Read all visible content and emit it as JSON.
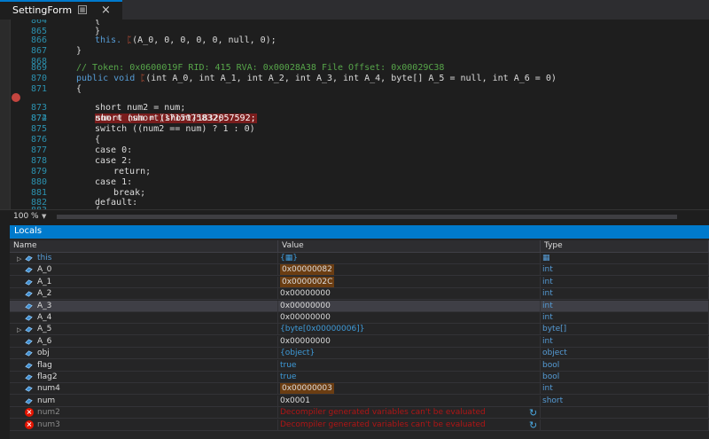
{
  "tab": {
    "title": "SettingForm",
    "pin_glyph": "▦",
    "close_glyph": "×"
  },
  "code_lines": [
    {
      "no": "864",
      "html": "{",
      "indent": "    "
    },
    {
      "no": "865",
      "html": "}",
      "indent": "    "
    },
    {
      "no": "866",
      "html": "this. ",
      "indent": "    ",
      "suffix": "(A_0, 0, 0, 0, 0, null, 0);"
    },
    {
      "no": "867",
      "html": "}",
      "indent": ""
    },
    {
      "no": "868",
      "html": "",
      "indent": ""
    },
    {
      "no": "869",
      "html": "// Token: 0x0600019F RID: 415 RVA: 0x00028A38 File Offset: 0x00029C38",
      "indent": ""
    },
    {
      "no": "870",
      "html": "public void ",
      "indent": ""
    },
    {
      "no": "871",
      "html": "{",
      "indent": ""
    },
    {
      "no": "872",
      "html": "short num = (short)1832057592;",
      "indent": "    "
    },
    {
      "no": "873",
      "html": "short num2 = num;",
      "indent": "    "
    },
    {
      "no": "874",
      "html": "num = (short)1715075832;",
      "indent": "    "
    },
    {
      "no": "875",
      "html": "switch ((num2 == num) ? 1 : 0)",
      "indent": "    "
    },
    {
      "no": "876",
      "html": "{",
      "indent": "    "
    },
    {
      "no": "877",
      "html": "case 0:",
      "indent": "    "
    },
    {
      "no": "878",
      "html": "case 2:",
      "indent": "    "
    },
    {
      "no": "879",
      "html": "return;",
      "indent": "        "
    },
    {
      "no": "880",
      "html": "case 1:",
      "indent": "    "
    },
    {
      "no": "881",
      "html": "break;",
      "indent": "        "
    },
    {
      "no": "882",
      "html": "default:",
      "indent": "    "
    },
    {
      "no": "883",
      "html": "{",
      "indent": "    "
    }
  ],
  "code": {
    "l864": "{",
    "l865": "}",
    "l866_a": "this.",
    "l866_b": "(A_0, 0, 0, 0, 0, null, 0);",
    "l867": "}",
    "l869": "// Token: 0x0600019F RID: 415 RVA: 0x00028A38 File Offset: 0x00029C38",
    "l870_kw1": "public",
    "l870_kw2": "void",
    "l870_params": "(int A_0, int A_1, int A_2, int A_3, int A_4, byte[] A_5 = null, int A_6 = 0)",
    "l871": "{",
    "l872": "short num = (short)1832057592;",
    "l873": "short num2 = num;",
    "l874": "num = (short)1715075832;",
    "l875": "switch ((num2 == num) ? 1 : 0)",
    "l876": "{",
    "l877": "case 0:",
    "l878": "case 2:",
    "l879": "return;",
    "l880": "case 1:",
    "l881": "break;",
    "l882": "default:",
    "l883": "{",
    "glyph": "ᛈ"
  },
  "line_numbers": [
    "864",
    "865",
    "866",
    "867",
    "868",
    "869",
    "870",
    "871",
    "872",
    "873",
    "874",
    "875",
    "876",
    "877",
    "878",
    "879",
    "880",
    "881",
    "882",
    "883"
  ],
  "zoom": "100 %",
  "locals": {
    "title": "Locals",
    "columns": {
      "name": "Name",
      "value": "Value",
      "type": "Type"
    },
    "rows": [
      {
        "name": "this",
        "value": "{▦}",
        "type": "▦",
        "expandable": true
      },
      {
        "name": "A_0",
        "value": "0x00000082",
        "type": "int",
        "changed": true
      },
      {
        "name": "A_1",
        "value": "0x0000002C",
        "type": "int",
        "changed": true
      },
      {
        "name": "A_2",
        "value": "0x00000000",
        "type": "int"
      },
      {
        "name": "A_3",
        "value": "0x00000000",
        "type": "int",
        "selected": true
      },
      {
        "name": "A_4",
        "value": "0x00000000",
        "type": "int"
      },
      {
        "name": "A_5",
        "value": "{byte[0x00000006]}",
        "type": "byte[]",
        "expandable": true
      },
      {
        "name": "A_6",
        "value": "0x00000000",
        "type": "int"
      },
      {
        "name": "obj",
        "value": "{object}",
        "type": "object"
      },
      {
        "name": "flag",
        "value": "true",
        "type": "bool"
      },
      {
        "name": "flag2",
        "value": "true",
        "type": "bool"
      },
      {
        "name": "num4",
        "value": "0x00000003",
        "type": "int",
        "changed": true
      },
      {
        "name": "num",
        "value": "0x0001",
        "type": "short"
      },
      {
        "name": "num2",
        "value": "Decompiler generated variables can't be evaluated",
        "type": "",
        "error": true
      },
      {
        "name": "num3",
        "value": "Decompiler generated variables can't be evaluated",
        "type": "",
        "error": true
      }
    ]
  },
  "colors": {
    "accent": "#007acc",
    "breakpoint": "#c5453f",
    "changed_value": "#6b3d12",
    "error": "#e51400"
  }
}
